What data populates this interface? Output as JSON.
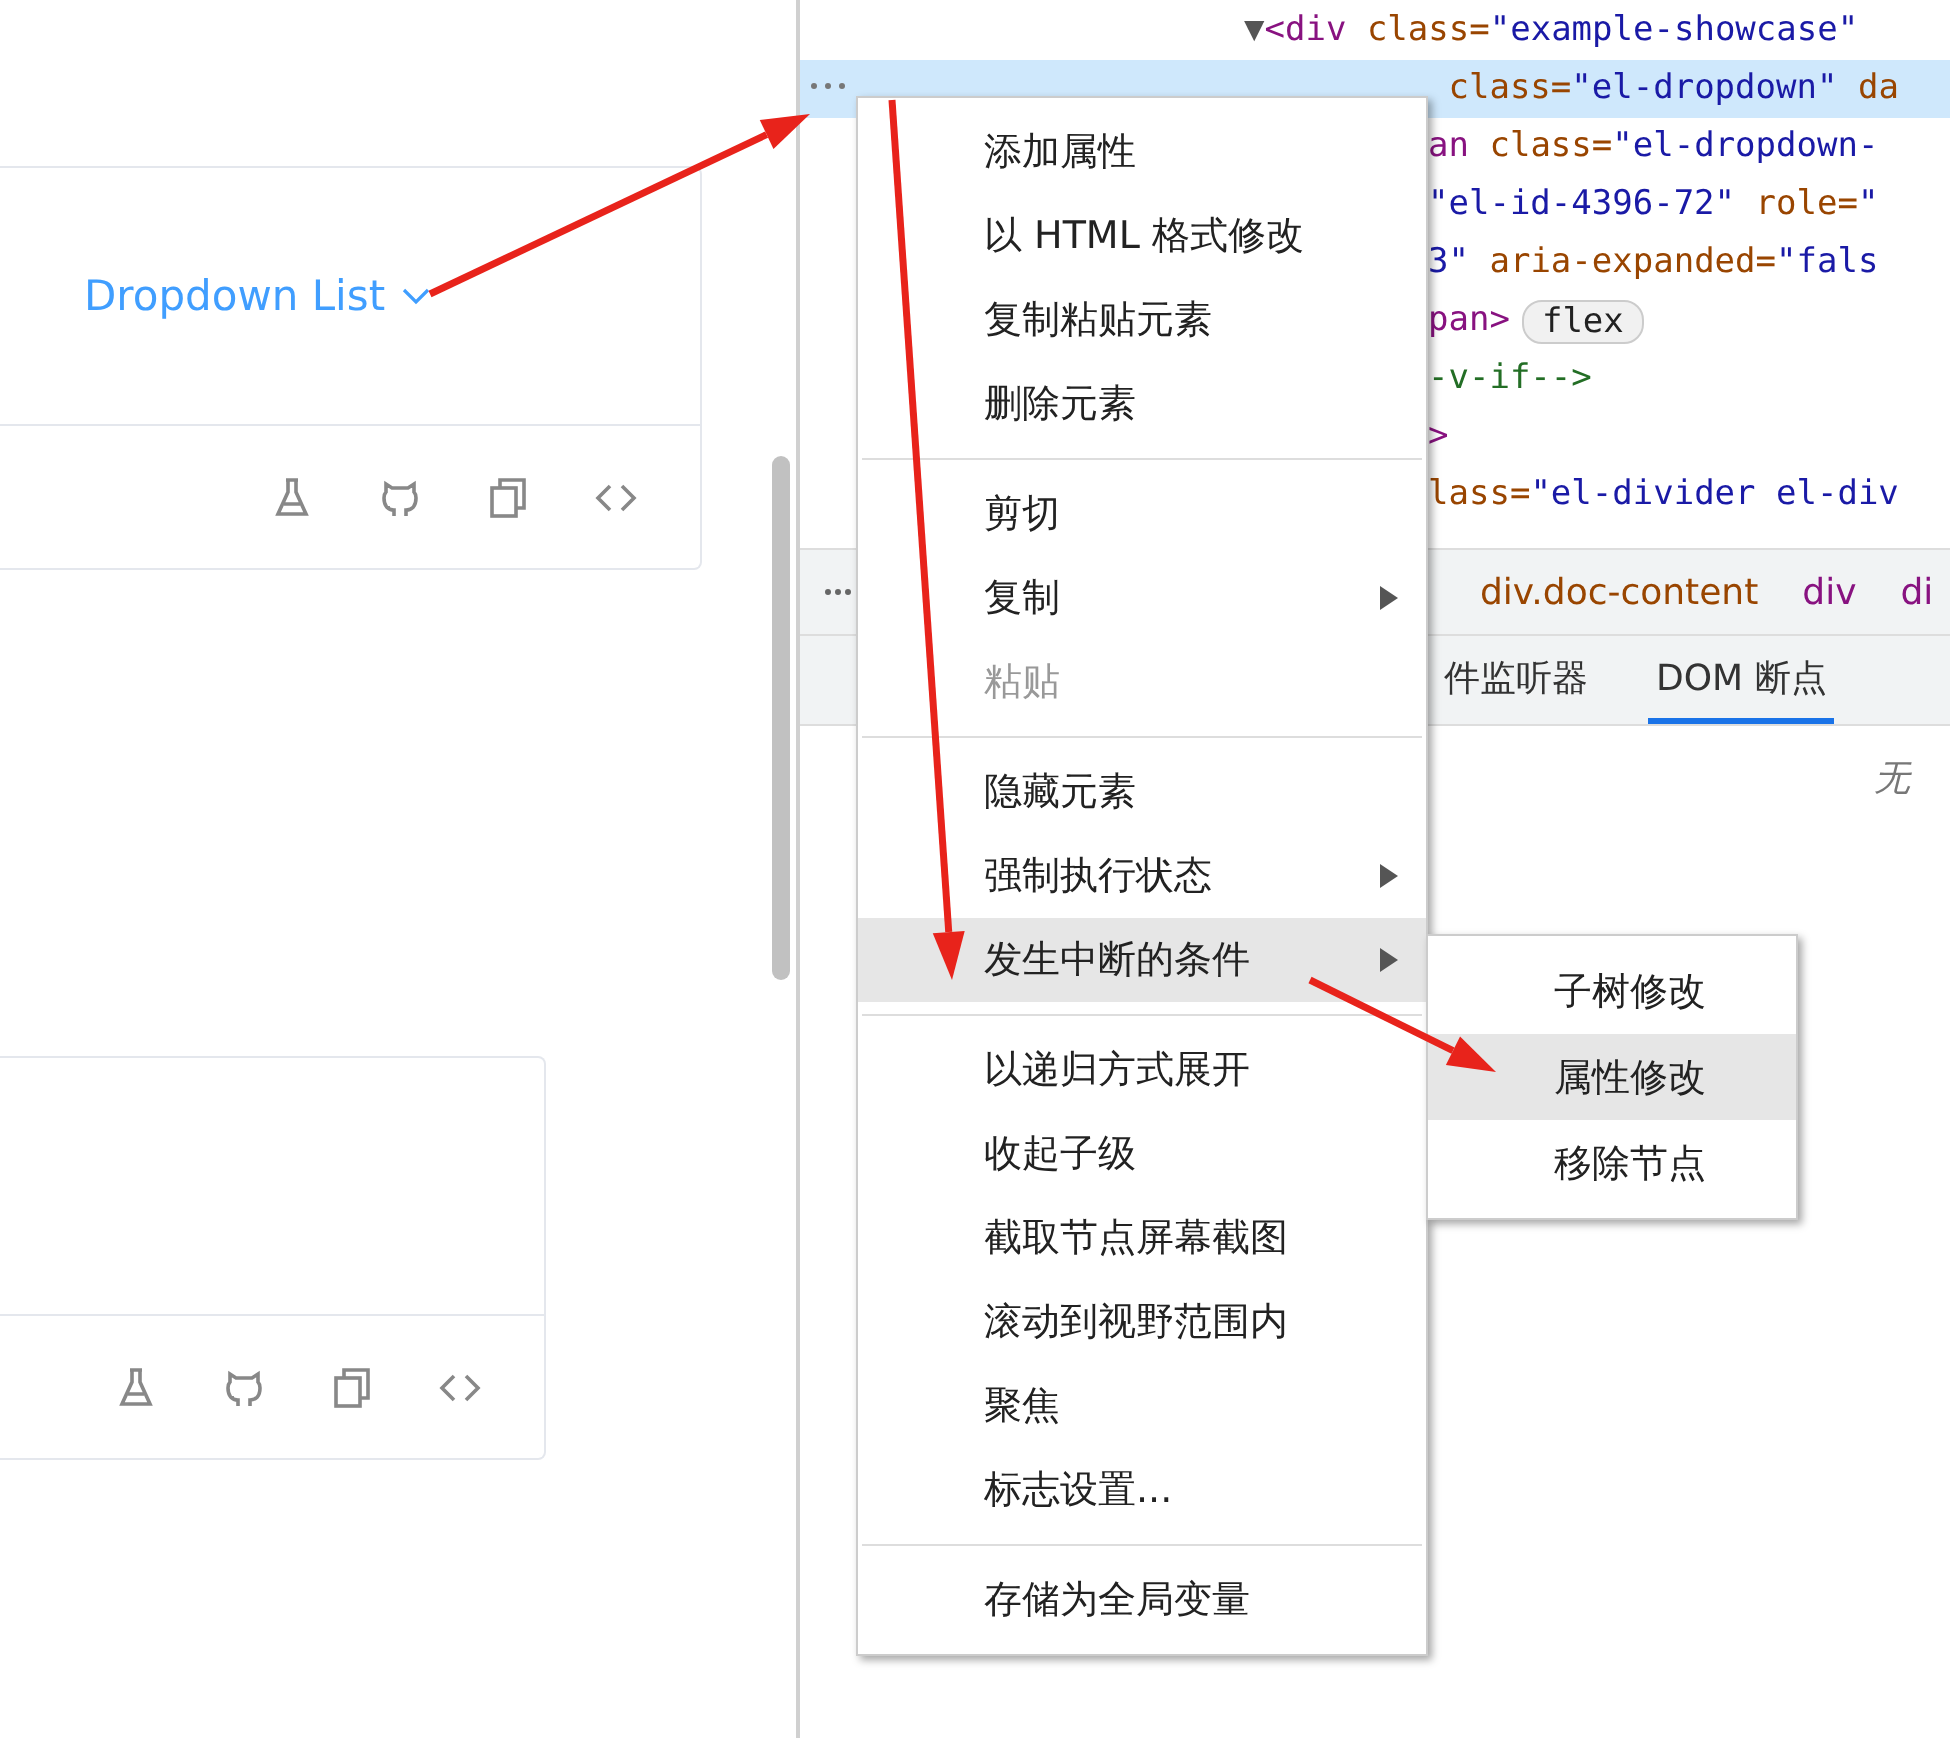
{
  "page": {
    "cards": [
      {
        "kind": "link",
        "link": "Dropdown List"
      },
      {
        "kind": "blank"
      }
    ]
  },
  "devtools": {
    "code_lines": [
      {
        "highlighted": false,
        "tokens": [
          {
            "kind": "tri",
            "text": "▼"
          },
          {
            "kind": "tag",
            "text": "<div"
          },
          {
            "kind": "attr",
            "text": " class="
          },
          {
            "kind": "value",
            "text": "\"example-showcase\""
          }
        ]
      },
      {
        "highlighted": true,
        "tokens": [
          {
            "kind": "attr",
            "text": " class="
          },
          {
            "kind": "value",
            "text": "\"el-dropdown\""
          },
          {
            "kind": "attr",
            "text": " da"
          }
        ]
      },
      {
        "highlighted": false,
        "tokens": [
          {
            "kind": "tag",
            "text": "an"
          },
          {
            "kind": "attr",
            "text": " class="
          },
          {
            "kind": "value",
            "text": "\"el-dropdown-"
          }
        ]
      },
      {
        "highlighted": false,
        "tokens": [
          {
            "kind": "value",
            "text": "\"el-id-4396-72\""
          },
          {
            "kind": "attr",
            "text": " role="
          },
          {
            "kind": "value",
            "text": "\""
          }
        ]
      },
      {
        "highlighted": false,
        "tokens": [
          {
            "kind": "value",
            "text": "3\""
          },
          {
            "kind": "attr",
            "text": " aria-expanded="
          },
          {
            "kind": "value",
            "text": "\"fals"
          }
        ]
      },
      {
        "highlighted": false,
        "tokens": [
          {
            "kind": "tag",
            "text": "pan>"
          },
          {
            "kind": "badge",
            "text": "flex"
          }
        ]
      },
      {
        "highlighted": false,
        "tokens": [
          {
            "kind": "comment",
            "text": "-v-if-->"
          }
        ]
      },
      {
        "highlighted": false,
        "tokens": [
          {
            "kind": "tag",
            "text": ">"
          }
        ]
      },
      {
        "highlighted": false,
        "tokens": [
          {
            "kind": "attr",
            "text": "lass="
          },
          {
            "kind": "value",
            "text": "\"el-divider el-div"
          }
        ]
      }
    ],
    "breadcrumbs": [
      "div.doc-content",
      "div",
      "di"
    ],
    "tabs": [
      {
        "label": "件监听器",
        "selected": false
      },
      {
        "label": "DOM 断点",
        "selected": true
      }
    ],
    "empty_note": "无"
  },
  "context_menu": {
    "groups": [
      [
        {
          "label": "添加属性",
          "selected": false,
          "disabled": false,
          "submenu": false
        },
        {
          "label": "以 HTML 格式修改",
          "selected": false,
          "disabled": false,
          "submenu": false
        },
        {
          "label": "复制粘贴元素",
          "selected": false,
          "disabled": false,
          "submenu": false
        },
        {
          "label": "删除元素",
          "selected": false,
          "disabled": false,
          "submenu": false
        }
      ],
      [
        {
          "label": "剪切",
          "selected": false,
          "disabled": false,
          "submenu": false
        },
        {
          "label": "复制",
          "selected": false,
          "disabled": false,
          "submenu": true
        },
        {
          "label": "粘贴",
          "selected": false,
          "disabled": true,
          "submenu": false
        }
      ],
      [
        {
          "label": "隐藏元素",
          "selected": false,
          "disabled": false,
          "submenu": false
        },
        {
          "label": "强制执行状态",
          "selected": false,
          "disabled": false,
          "submenu": true
        },
        {
          "label": "发生中断的条件",
          "selected": true,
          "disabled": false,
          "submenu": true
        }
      ],
      [
        {
          "label": "以递归方式展开",
          "selected": false,
          "disabled": false,
          "submenu": false
        },
        {
          "label": "收起子级",
          "selected": false,
          "disabled": false,
          "submenu": false
        },
        {
          "label": "截取节点屏幕截图",
          "selected": false,
          "disabled": false,
          "submenu": false
        },
        {
          "label": "滚动到视野范围内",
          "selected": false,
          "disabled": false,
          "submenu": false
        },
        {
          "label": "聚焦",
          "selected": false,
          "disabled": false,
          "submenu": false
        },
        {
          "label": "标志设置...",
          "selected": false,
          "disabled": false,
          "submenu": false
        }
      ],
      [
        {
          "label": "存储为全局变量",
          "selected": false,
          "disabled": false,
          "submenu": false
        }
      ]
    ]
  },
  "submenu": {
    "items": [
      {
        "label": "子树修改",
        "selected": false
      },
      {
        "label": "属性修改",
        "selected": true
      },
      {
        "label": "移除节点",
        "selected": false
      }
    ]
  }
}
